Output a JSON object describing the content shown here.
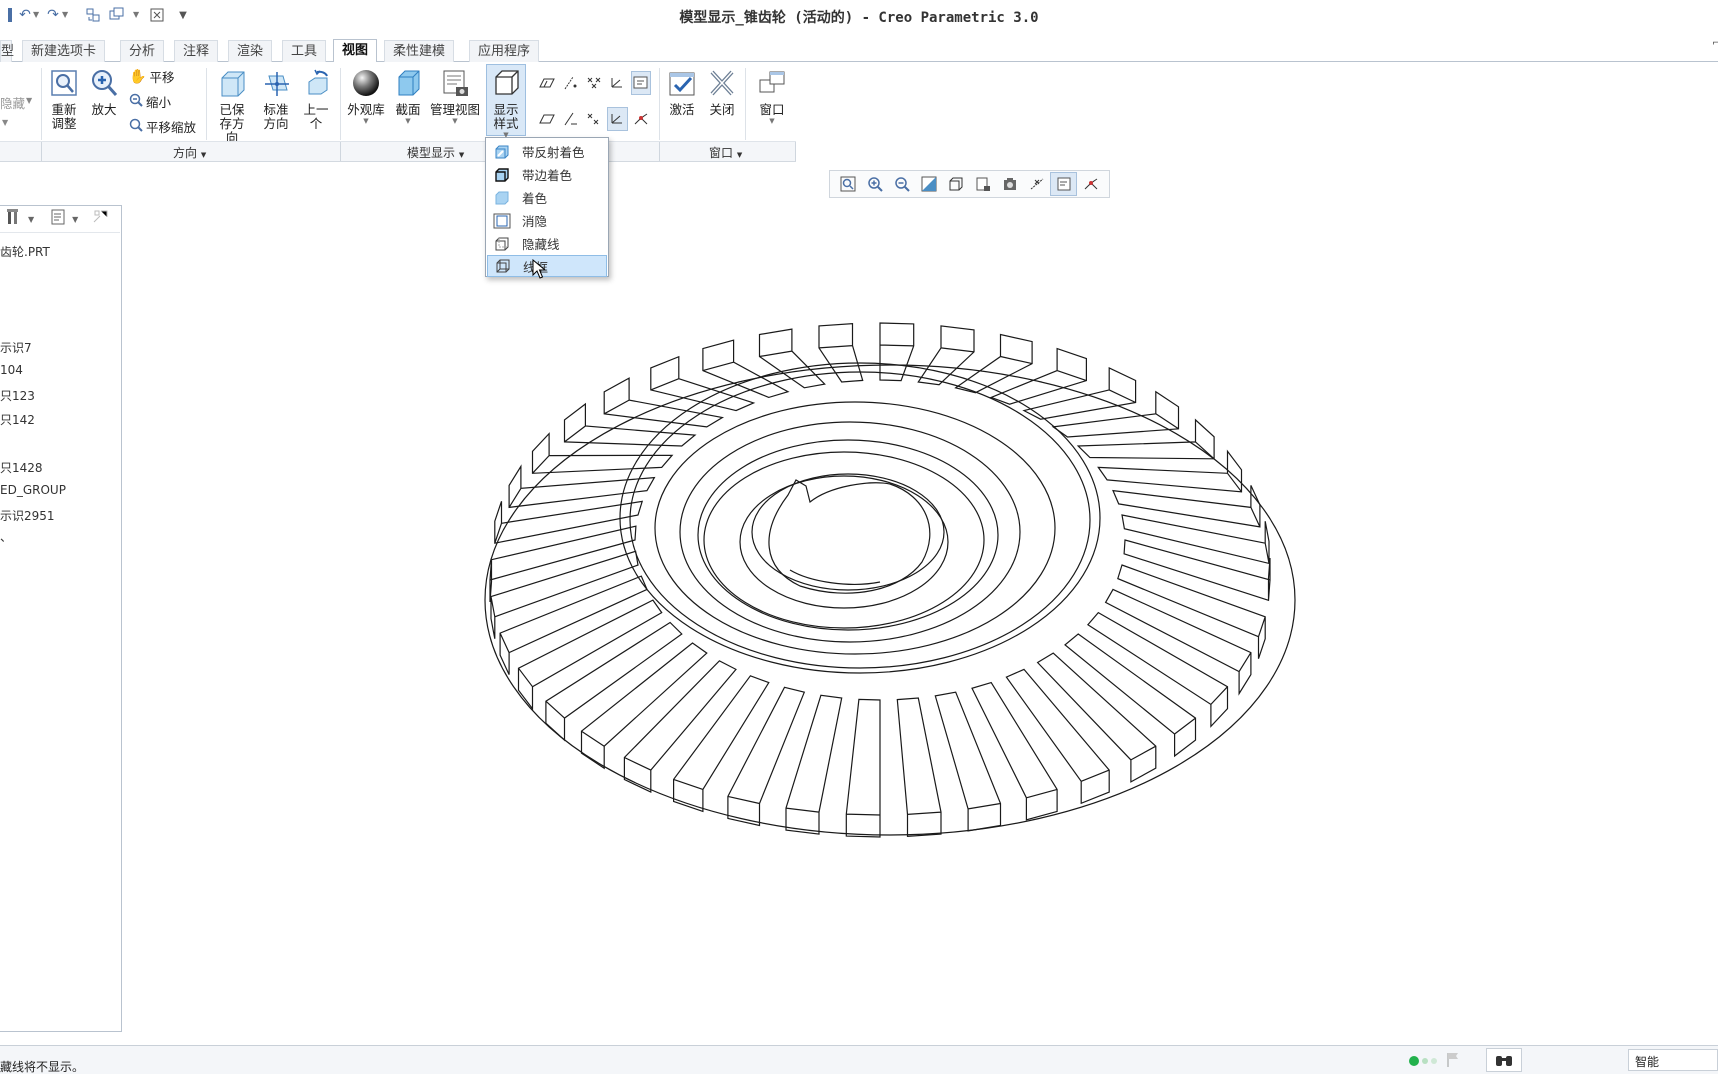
{
  "window": {
    "title": "模型显示_锥齿轮 (活动的) - Creo Parametric 3.0"
  },
  "quick_access": [
    "save-icon",
    "undo-icon",
    "redo-icon",
    "regenerate-icon",
    "window-icon",
    "close-window-icon",
    "customize-icon"
  ],
  "tabs": [
    {
      "label": "型"
    },
    {
      "label": "新建选项卡"
    },
    {
      "label": "分析"
    },
    {
      "label": "注释"
    },
    {
      "label": "渲染"
    },
    {
      "label": "工具"
    },
    {
      "label": "视图",
      "active": true
    },
    {
      "label": "柔性建模"
    },
    {
      "label": "应用程序"
    }
  ],
  "ribbon": {
    "hide_label": "隐藏",
    "refit_label": "重新调整",
    "zoom_in_label": "放大",
    "pan_label": "平移",
    "zoom_out_label": "缩小",
    "pan_zoom_label": "平移缩放",
    "saved_orient_label": "已保存方向",
    "std_orient_label": "标准方向",
    "prev_label": "上一个",
    "appearance_label": "外观库",
    "section_label": "截面",
    "manage_views_label": "管理视图",
    "display_style_label": "显示样式",
    "activate_label": "激活",
    "close_label": "关闭",
    "window_label": "窗口"
  },
  "groups": {
    "orientation": "方向",
    "model_display": "模型显示",
    "window": "窗口"
  },
  "display_menu": {
    "items": [
      {
        "label": "带反射着色"
      },
      {
        "label": "带边着色"
      },
      {
        "label": "着色"
      },
      {
        "label": "消隐"
      },
      {
        "label": "隐藏线"
      },
      {
        "label": "线框",
        "selected": true
      }
    ]
  },
  "model_tree": {
    "items": [
      "齿轮.PRT",
      "示识7",
      "104",
      "只123",
      "只142",
      "只1428",
      "ED_GROUP",
      "示识2951",
      "、"
    ]
  },
  "status": {
    "message": "藏线将不显示。",
    "filter": "智能"
  },
  "colors": {
    "accent": "#4a6fa5",
    "selection": "#cfe6fb",
    "status_green": "#22b14c"
  }
}
